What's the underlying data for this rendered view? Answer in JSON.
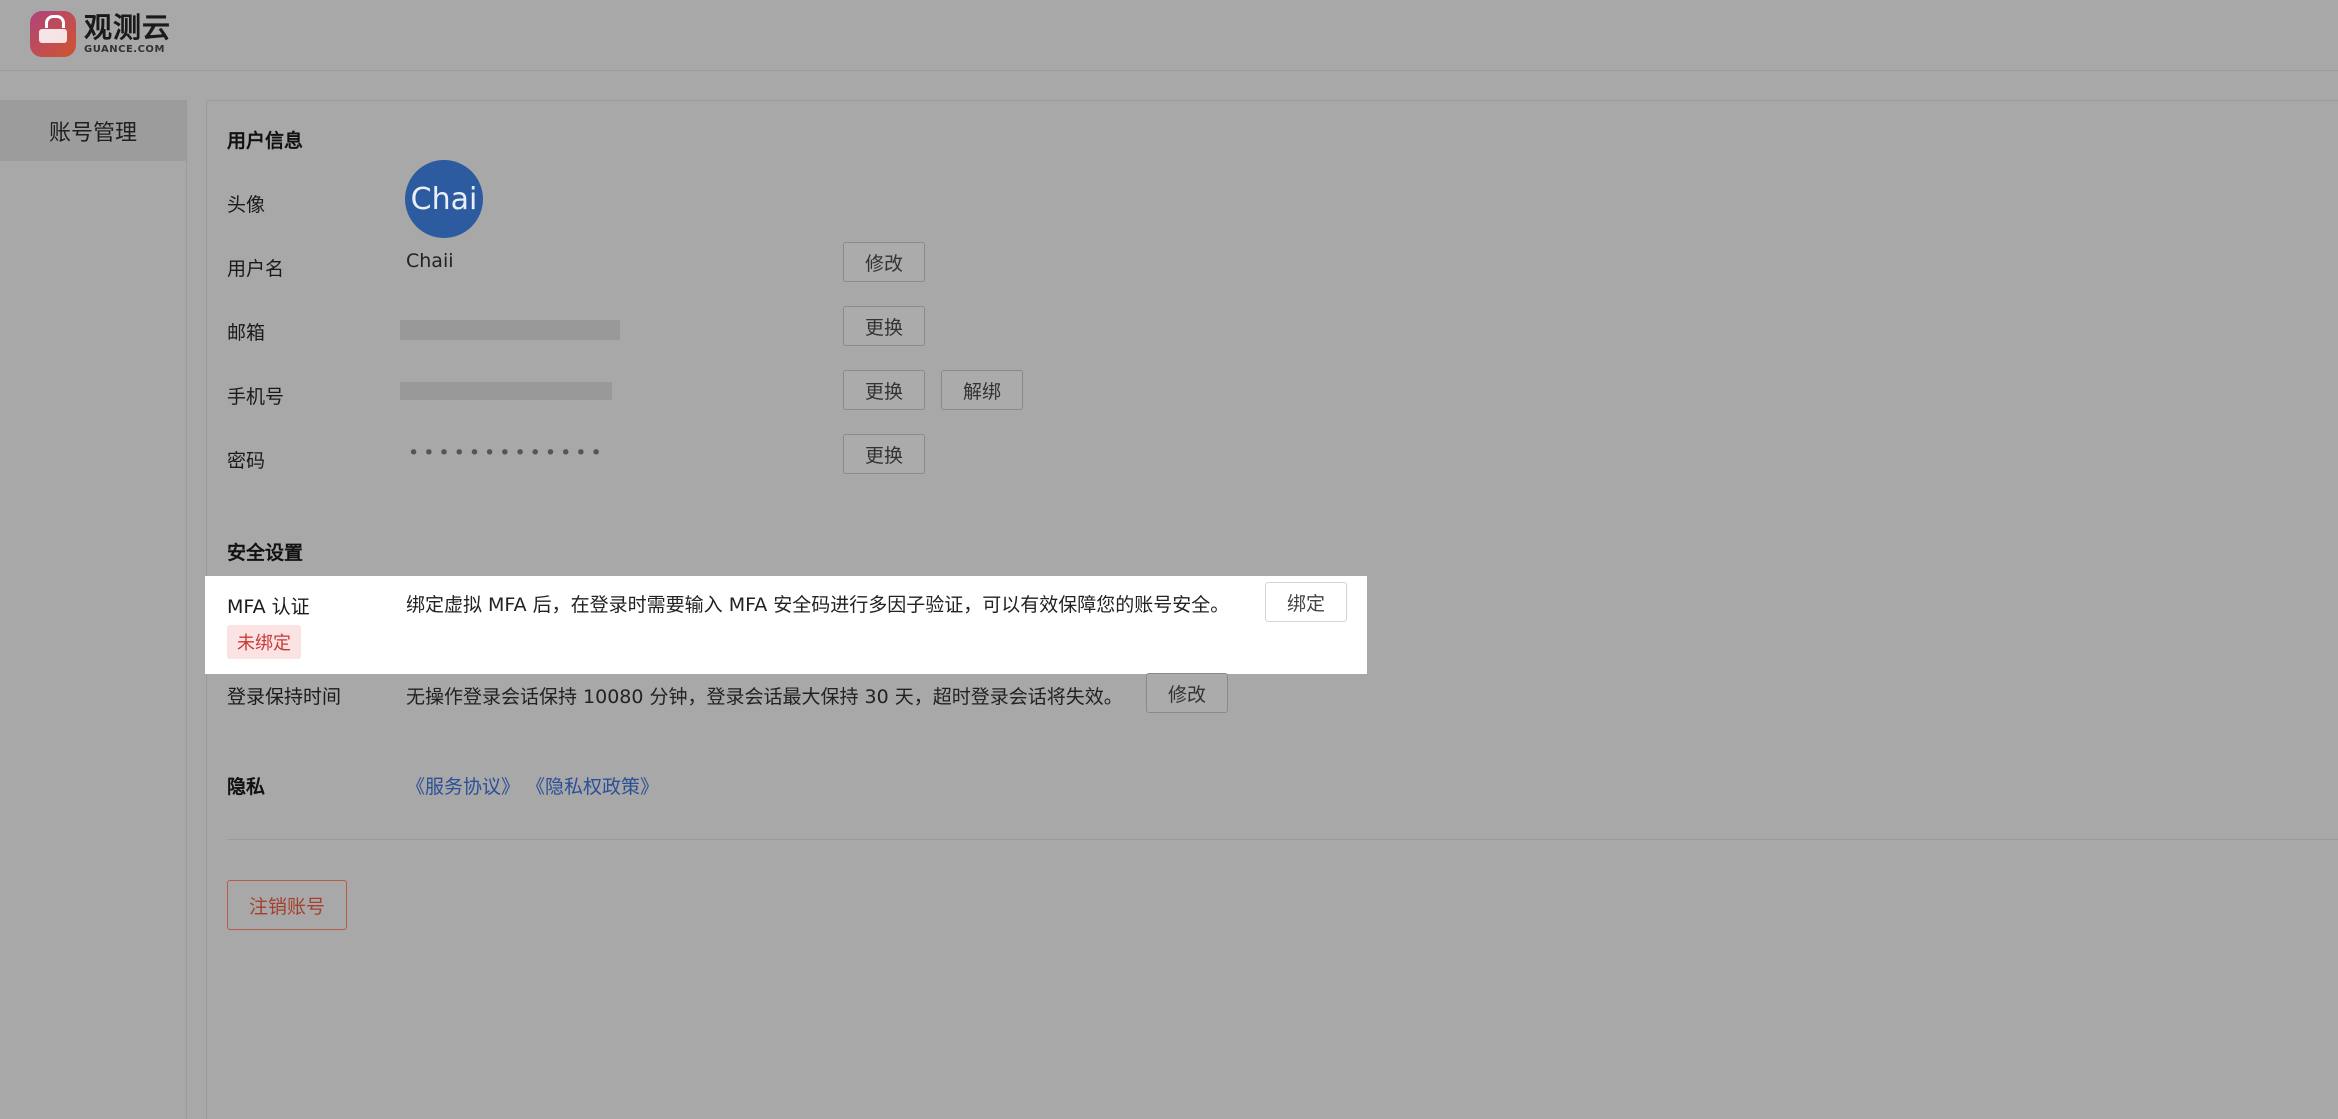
{
  "brand": {
    "name_cn": "观测云",
    "name_en": "GUANCE.COM"
  },
  "sidebar": {
    "items": [
      {
        "label": "账号管理",
        "active": true
      }
    ]
  },
  "user_info": {
    "title": "用户信息",
    "avatar": {
      "label": "头像",
      "initials": "Chai"
    },
    "username": {
      "label": "用户名",
      "value": "Chaii",
      "button": "修改"
    },
    "email": {
      "label": "邮箱",
      "button": "更换"
    },
    "phone": {
      "label": "手机号",
      "button_change": "更换",
      "button_unbind": "解绑"
    },
    "password": {
      "label": "密码",
      "value": "•••••••••••••",
      "button": "更换"
    }
  },
  "security": {
    "title": "安全设置",
    "mfa": {
      "label": "MFA 认证",
      "status": "未绑定",
      "description": "绑定虚拟 MFA 后，在登录时需要输入 MFA 安全码进行多因子验证，可以有效保障您的账号安全。",
      "button": "绑定"
    },
    "session": {
      "label": "登录保持时间",
      "description": "无操作登录会话保持 10080 分钟，登录会话最大保持 30 天，超时登录会话将失效。",
      "button": "修改"
    }
  },
  "privacy": {
    "label": "隐私",
    "links": [
      "《服务协议》",
      "《隐私权政策》"
    ]
  },
  "danger": {
    "delete_account": "注销账号"
  },
  "colors": {
    "avatar": "#3b7bd6",
    "status_red": "#d9363e",
    "link": "#3567d4",
    "danger": "#d4553a"
  }
}
